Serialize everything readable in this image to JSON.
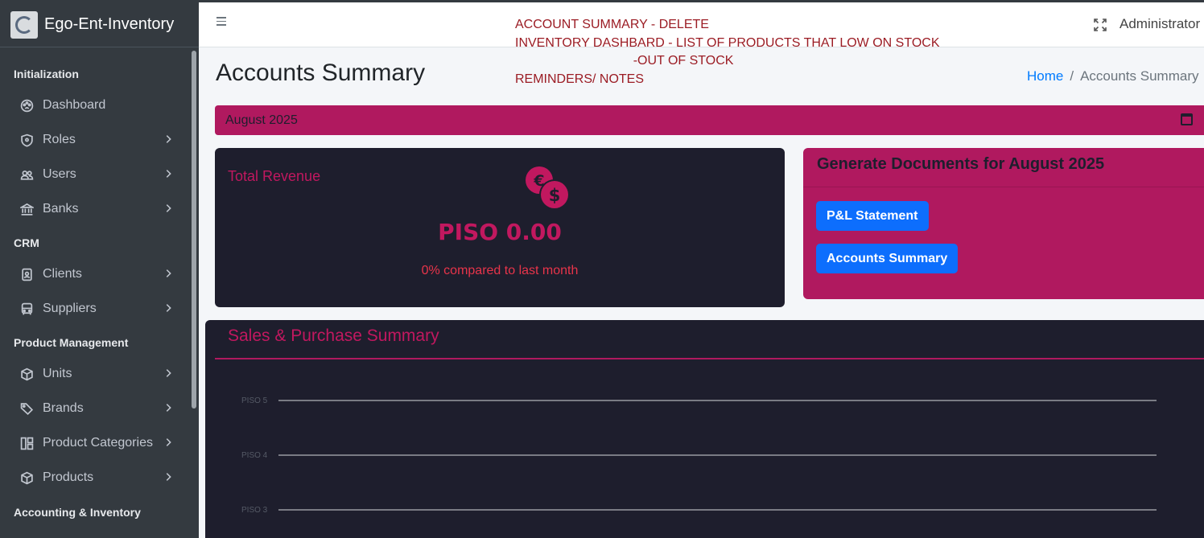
{
  "brand": {
    "name": "Ego-Ent-Inventory"
  },
  "sidebar": {
    "sections": [
      {
        "header": "Initialization",
        "items": [
          {
            "label": "Dashboard",
            "icon": "palette-icon",
            "has_children": false
          },
          {
            "label": "Roles",
            "icon": "shield-icon",
            "has_children": true
          },
          {
            "label": "Users",
            "icon": "users-icon",
            "has_children": true
          },
          {
            "label": "Banks",
            "icon": "bank-icon",
            "has_children": true
          }
        ]
      },
      {
        "header": "CRM",
        "items": [
          {
            "label": "Clients",
            "icon": "badge-icon",
            "has_children": true
          },
          {
            "label": "Suppliers",
            "icon": "bus-icon",
            "has_children": true
          }
        ]
      },
      {
        "header": "Product Management",
        "items": [
          {
            "label": "Units",
            "icon": "box-icon",
            "has_children": true
          },
          {
            "label": "Brands",
            "icon": "tags-icon",
            "has_children": true
          },
          {
            "label": "Product Categories",
            "icon": "layout-icon",
            "has_children": true
          },
          {
            "label": "Products",
            "icon": "box-icon",
            "has_children": true
          }
        ]
      },
      {
        "header": "Accounting & Inventory",
        "items": []
      }
    ]
  },
  "navbar": {
    "notes": "ACCOUNT SUMMARY - DELETE\nINVENTORY DASHBARD - LIST OF PRODUCTS THAT LOW ON STOCK\n                                 -OUT OF STOCK\nREMINDERS/ NOTES",
    "user": "Administrator"
  },
  "page": {
    "title": "Accounts Summary",
    "breadcrumb": {
      "home": "Home",
      "separator": "/",
      "current": "Accounts Summary"
    },
    "month": "August 2025"
  },
  "revenue": {
    "label": "Total Revenue",
    "value": "PISO 0.00",
    "compare": "0% compared to last month"
  },
  "documents": {
    "title": "Generate Documents for August 2025",
    "buttons": [
      "P&L Statement",
      "Accounts Summary"
    ]
  },
  "sales": {
    "title": "Sales & Purchase Summary"
  },
  "chart_data": {
    "type": "line",
    "title": "Sales & Purchase Summary",
    "y_ticks": [
      "PISO 5",
      "PISO 4",
      "PISO 3"
    ],
    "y_values": [
      5,
      4,
      3
    ],
    "grid": true,
    "series": []
  },
  "colors": {
    "sidebar_bg": "#343a40",
    "accent": "#b0195f",
    "card_dark": "#1e1e2d",
    "primary_button": "#0d6efd",
    "note_text": "#9b1c24"
  }
}
